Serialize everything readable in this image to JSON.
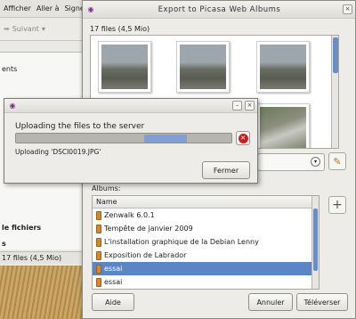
{
  "back_window": {
    "menu": [
      "Afficher",
      "Aller à",
      "Signe"
    ],
    "forward_label": "Suivant",
    "sidebar": [
      "ents",
      "le fichiers",
      "s"
    ],
    "status": "17 files (4,5 Mio)"
  },
  "export_window": {
    "title": "Export to Picasa Web Albums",
    "file_count": "17 files (4,5 Mio)",
    "albums_label": "Albums:",
    "column_name": "Name",
    "albums": [
      {
        "name": "Zenwalk 6.0.1",
        "selected": false
      },
      {
        "name": "Tempête de janvier 2009",
        "selected": false
      },
      {
        "name": "L'installation graphique de la Debian Lenny",
        "selected": false
      },
      {
        "name": "Exposition de Labrador",
        "selected": false
      },
      {
        "name": "essai",
        "selected": true
      },
      {
        "name": "essai",
        "selected": false
      }
    ],
    "help_label": "Aide",
    "cancel_label": "Annuler",
    "upload_label": "Téléverser"
  },
  "upload_dialog": {
    "heading": "Uploading the files to the server",
    "status": "Uploading 'DSCI0019.JPG'",
    "close_label": "Fermer"
  },
  "colors": {
    "selection": "#5a86c8",
    "cancel_icon": "#c8201e",
    "progress_pulse": "#7fa0d6"
  }
}
